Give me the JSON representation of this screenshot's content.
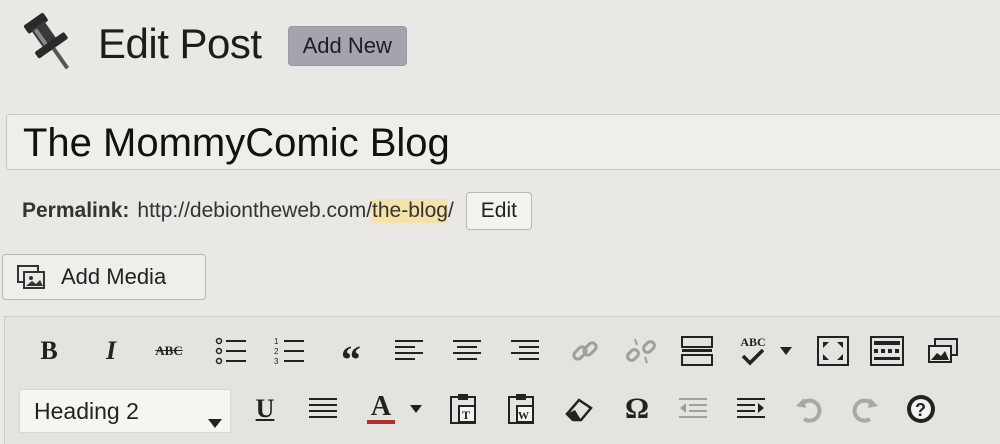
{
  "header": {
    "title": "Edit Post",
    "add_new_label": "Add New"
  },
  "post": {
    "title_value": "The MommyComic Blog"
  },
  "permalink": {
    "label": "Permalink:",
    "base_url": "http://debiontheweb.com/",
    "slug": "the-blog",
    "trailing": "/",
    "edit_label": "Edit"
  },
  "media": {
    "add_media_label": "Add Media"
  },
  "toolbar": {
    "row1_icons": [
      "bold-icon",
      "italic-icon",
      "strikethrough-icon",
      "bullet-list-icon",
      "numbered-list-icon",
      "blockquote-icon",
      "align-left-icon",
      "align-center-icon",
      "align-right-icon",
      "insert-link-icon",
      "remove-link-icon",
      "read-more-icon",
      "spellcheck-icon",
      "fullscreen-icon",
      "toolbar-toggle-icon",
      "media-gallery-icon"
    ],
    "bold_glyph": "B",
    "italic_glyph": "I",
    "strike_glyph": "ABC",
    "spell_glyph": "ABC",
    "quote_glyph": "“",
    "format_select_value": "Heading 2",
    "underline_glyph": "U",
    "text_color_glyph": "A",
    "special_char_glyph": "Ω",
    "row2_icons": [
      "format-select",
      "underline-icon",
      "justify-icon",
      "text-color-icon",
      "paste-text-icon",
      "paste-word-icon",
      "clear-formatting-icon",
      "special-character-icon",
      "outdent-icon",
      "indent-icon",
      "undo-icon",
      "redo-icon",
      "help-icon"
    ]
  },
  "colors": {
    "background": "#e9e8e4",
    "add_new_bg": "#a7a3ad",
    "slug_highlight": "#f5e2a8",
    "text_color_underline": "#b03030"
  }
}
